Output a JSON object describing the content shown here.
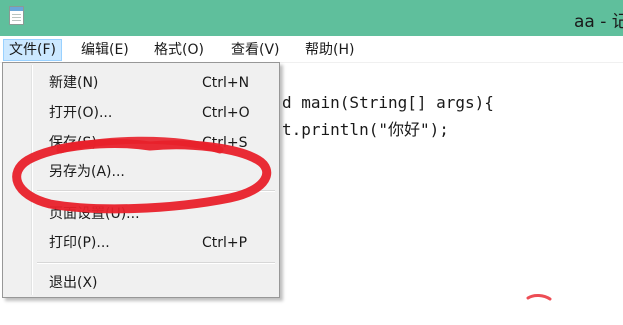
{
  "window": {
    "title": "aa - 记"
  },
  "menubar": {
    "items": [
      {
        "label": "文件(F)",
        "active": true
      },
      {
        "label": "编辑(E)"
      },
      {
        "label": "格式(O)"
      },
      {
        "label": "查看(V)"
      },
      {
        "label": "帮助(H)"
      }
    ]
  },
  "file_menu": {
    "items": [
      {
        "label": "新建(N)",
        "shortcut": "Ctrl+N"
      },
      {
        "label": "打开(O)...",
        "shortcut": "Ctrl+O"
      },
      {
        "label": "保存(S)",
        "shortcut": "Ctrl+S"
      },
      {
        "label": "另存为(A)...",
        "shortcut": ""
      },
      {
        "label": "页面设置(U)...",
        "shortcut": ""
      },
      {
        "label": "打印(P)...",
        "shortcut": "Ctrl+P"
      },
      {
        "label": "退出(X)",
        "shortcut": ""
      }
    ]
  },
  "editor": {
    "lines": [
      "d main(String[] args){",
      "t.println(\"你好\");"
    ]
  },
  "annotation": {
    "color": "#e8202a"
  }
}
